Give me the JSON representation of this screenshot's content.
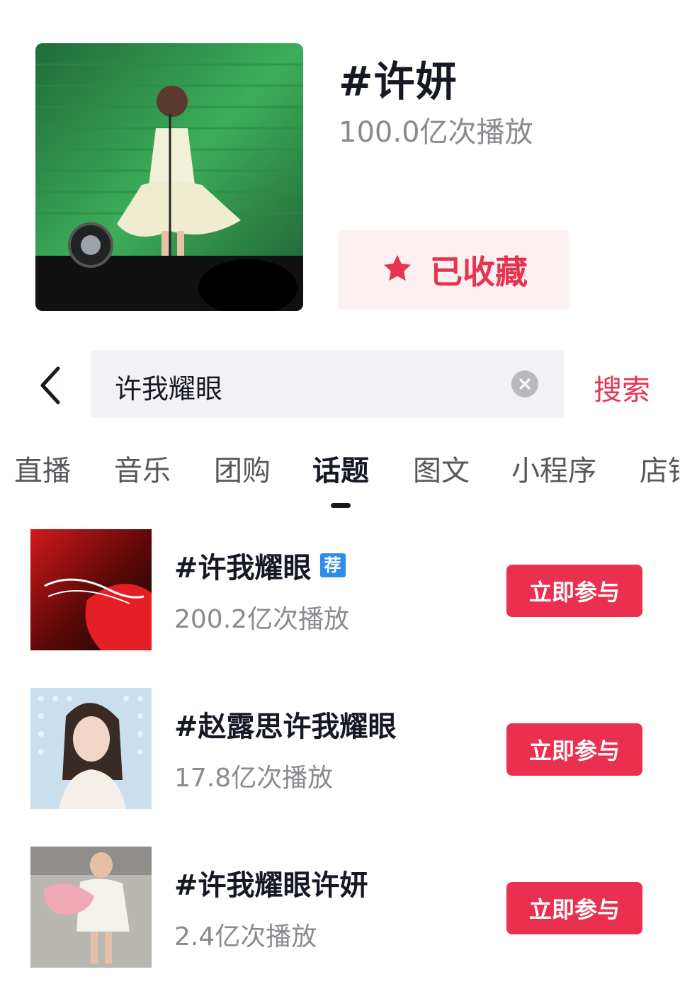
{
  "header": {
    "title": "#许妍",
    "plays": "100.0亿次播放",
    "favorite_label": "已收藏"
  },
  "search": {
    "query": "许我耀眼",
    "search_label": "搜索"
  },
  "tabs": [
    {
      "label": "直播"
    },
    {
      "label": "音乐"
    },
    {
      "label": "团购"
    },
    {
      "label": "话题"
    },
    {
      "label": "图文"
    },
    {
      "label": "小程序"
    },
    {
      "label": "店铺"
    }
  ],
  "active_tab": "话题",
  "results": [
    {
      "name": "#许我耀眼",
      "badge": "荐",
      "plays": "200.2亿次播放",
      "action": "立即参与"
    },
    {
      "name": "#赵露思许我耀眼",
      "plays": "17.8亿次播放",
      "action": "立即参与"
    },
    {
      "name": "#许我耀眼许妍",
      "plays": "2.4亿次播放",
      "action": "立即参与"
    }
  ],
  "colors": {
    "accent": "#eb2f4e",
    "badge": "#2c8ded",
    "fav_bg": "#fdf0f1"
  }
}
